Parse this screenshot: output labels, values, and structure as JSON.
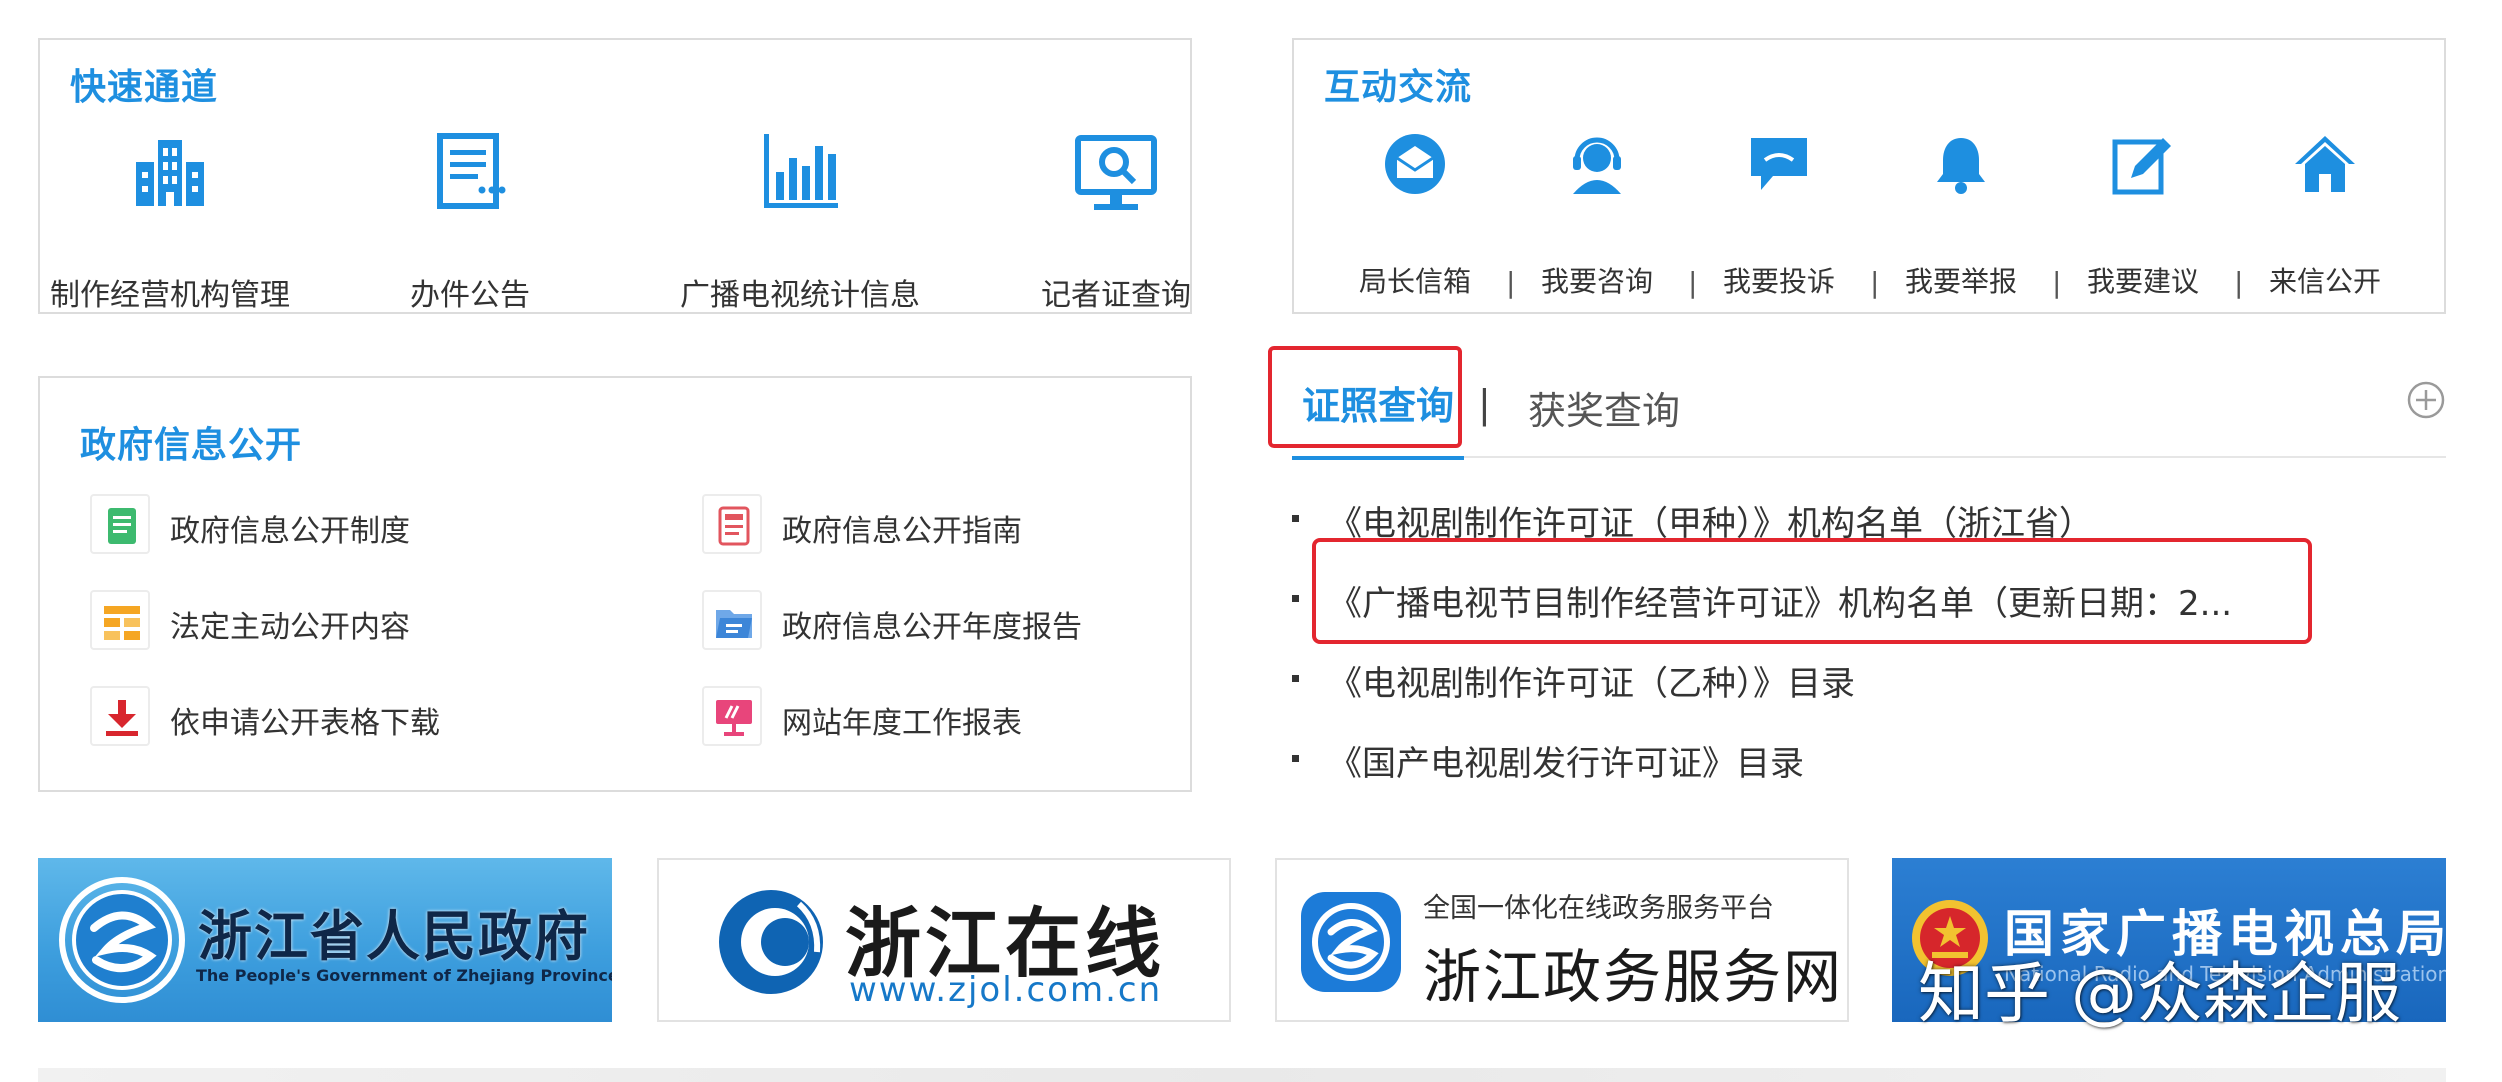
{
  "quick_access": {
    "title": "快速通道",
    "items": [
      {
        "label": "制作经营机构管理",
        "icon": "building-icon"
      },
      {
        "label": "办件公告",
        "icon": "document-list-icon"
      },
      {
        "label": "广播电视统计信息",
        "icon": "bar-chart-icon"
      },
      {
        "label": "记者证查询",
        "icon": "monitor-search-icon"
      }
    ]
  },
  "interactive": {
    "title": "互动交流",
    "separator": "|",
    "items": [
      {
        "label": "局长信箱",
        "icon": "mail-icon"
      },
      {
        "label": "我要咨询",
        "icon": "headset-user-icon"
      },
      {
        "label": "我要投诉",
        "icon": "chat-bubble-icon"
      },
      {
        "label": "我要举报",
        "icon": "bell-icon"
      },
      {
        "label": "我要建议",
        "icon": "edit-icon"
      },
      {
        "label": "来信公开",
        "icon": "home-icon"
      }
    ]
  },
  "gov_info": {
    "title": "政府信息公开",
    "items": [
      {
        "label": "政府信息公开制度",
        "icon": "green-doc-icon"
      },
      {
        "label": "政府信息公开指南",
        "icon": "red-doc-icon"
      },
      {
        "label": "法定主动公开内容",
        "icon": "yellow-grid-icon"
      },
      {
        "label": "政府信息公开年度报告",
        "icon": "blue-folder-icon"
      },
      {
        "label": "依申请公开表格下载",
        "icon": "download-icon"
      },
      {
        "label": "网站年度工作报表",
        "icon": "presentation-icon"
      }
    ]
  },
  "license": {
    "tab_active": "证照查询",
    "tab_separator": "|",
    "tab_other": "获奖查询",
    "more_icon": "plus-circle-icon",
    "items": [
      "《电视剧制作许可证（甲种）》机构名单（浙江省）",
      "《广播电视节目制作经营许可证》机构名单（更新日期：2...",
      "《电视剧制作许可证（乙种）》目录",
      "《国产电视剧发行许可证》目录"
    ]
  },
  "banners": {
    "zj_gov": {
      "cn": "浙江省人民政府",
      "en": "The People's Government of Zhejiang Province"
    },
    "zjol": {
      "cn": "浙江在线",
      "url_text": "www.zjol.com.cn"
    },
    "zwfw": {
      "sub": "全国一体化在线政务服务平台",
      "cn": "浙江政务服务网"
    },
    "nrta": {
      "cn": "国家广播电视总局",
      "en": "National Radio and Television Administration"
    }
  },
  "watermark": "知乎 @众森企服",
  "colors": {
    "accent": "#1e8fe0",
    "highlight": "#e3262f",
    "border": "#dcdcdc",
    "text": "#333333"
  }
}
